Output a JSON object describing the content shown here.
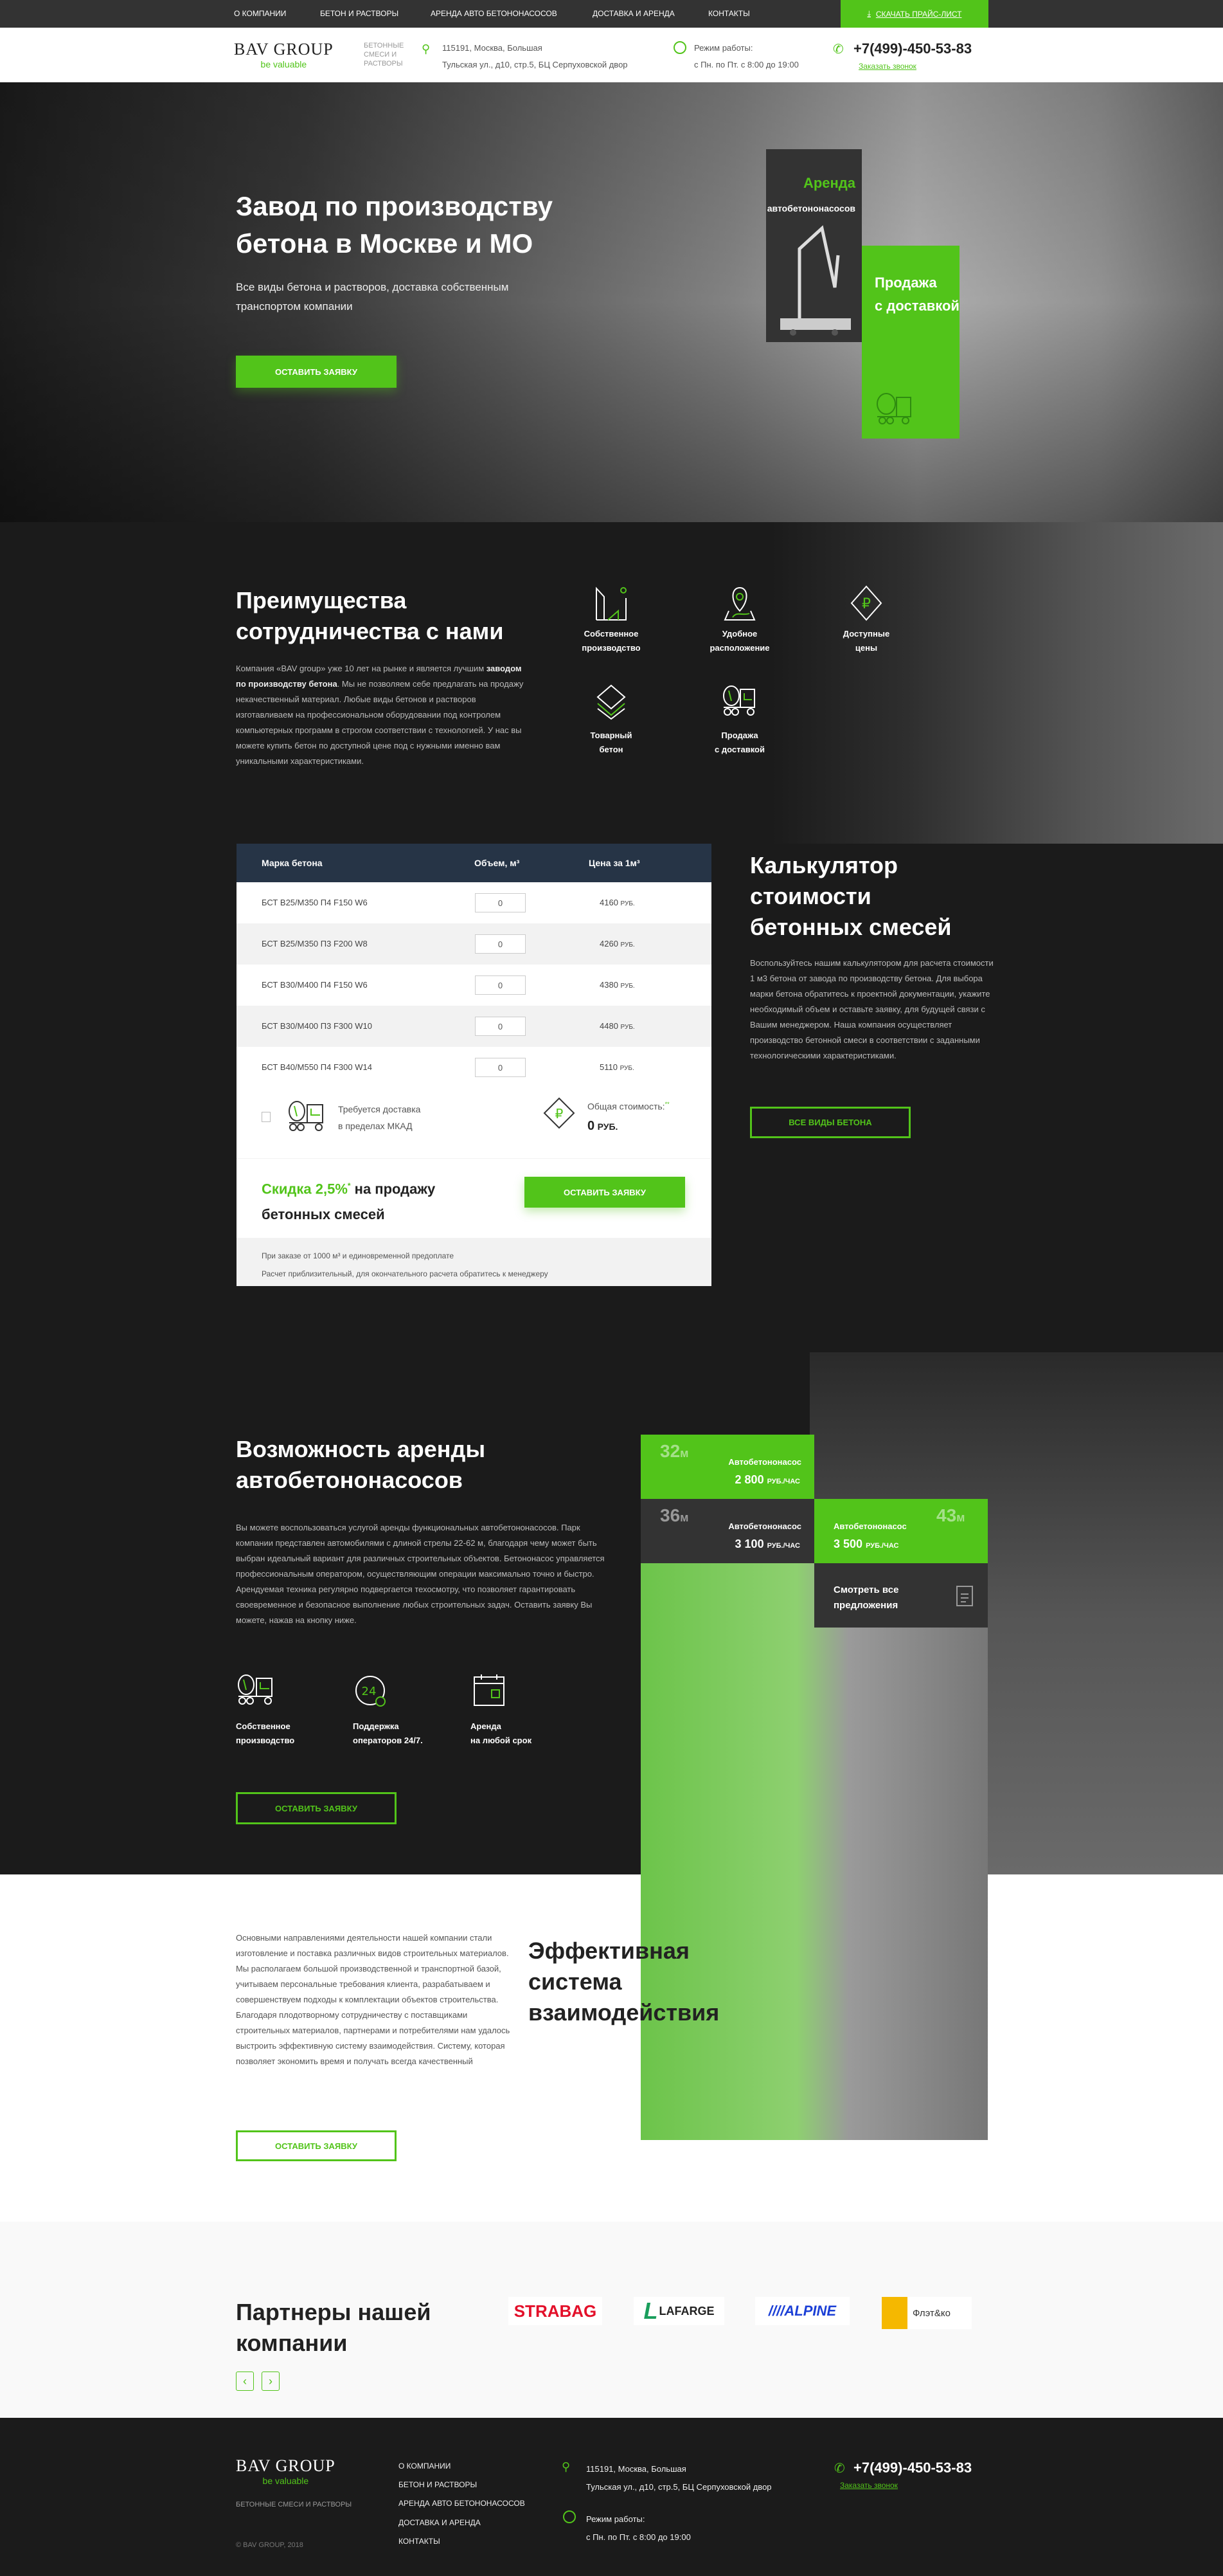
{
  "topnav": {
    "items": [
      "О компании",
      "Бетон и растворы",
      "Аренда авто бетононасосов",
      "Доставка и аренда",
      "Контакты"
    ],
    "price_list": "Скачать прайс-лист"
  },
  "header": {
    "logo": "BAV GROUP",
    "logo_sub": "be valuable",
    "tagline": [
      "БЕТОННЫЕ",
      "СМЕСИ И",
      "РАСТВОРЫ"
    ],
    "address": [
      "115191, Москва, Большая",
      "Тульская ул., д10, стр.5, БЦ Серпуховской двор"
    ],
    "hours": [
      "Режим работы:",
      "с Пн. по Пт. с 8:00 до 19:00"
    ],
    "phone": "+7(499)-450-53-83",
    "call": "Заказать звонок"
  },
  "hero": {
    "title": [
      "Завод по производству",
      "бетона в Москве и МО"
    ],
    "subtitle": [
      "Все виды бетона и растворов, доставка собственным",
      "транспортом компании"
    ],
    "cta": "Оставить заявку",
    "banner_rent": {
      "title": "Аренда",
      "sub": "автобетононасосов"
    },
    "banner_sale": [
      "Продажа",
      "с доставкой"
    ]
  },
  "advantages": {
    "title": [
      "Преимущества",
      "сотрудничества с нами"
    ],
    "text_pre": "Компания «BAV group» уже 10 лет на рынке и является лучшим ",
    "text_bold": "заводом по производству бетона",
    "text_post": ". Мы не позволяем себе предлагать на продажу некачественный материал. Любые виды бетонов и растворов изготавливаем на профессиональном оборудовании под контролем компьютерных программ в строгом соответствии с технологией. У нас вы можете купить бетон по доступной цене под с нужными именно вам уникальными характеристиками.",
    "items": [
      [
        "Собственное",
        "производство"
      ],
      [
        "Удобное",
        "расположение"
      ],
      [
        "Доступные",
        "цены"
      ],
      [
        "Товарный",
        "бетон"
      ],
      [
        "Продажа",
        "с доставкой"
      ]
    ]
  },
  "calculator": {
    "headers": [
      "Марка бетона",
      "Объем, м³",
      "Цена за 1м³"
    ],
    "rows": [
      {
        "grade": "БСТ В25/М350 П4 F150 W6",
        "volume": "0",
        "price": "4160",
        "unit": "РУБ."
      },
      {
        "grade": "БСТ В25/М350 П3 F200 W8",
        "volume": "0",
        "price": "4260",
        "unit": "РУБ."
      },
      {
        "grade": "БСТ В30/М400 П4 F150 W6",
        "volume": "0",
        "price": "4380",
        "unit": "РУБ."
      },
      {
        "grade": "БСТ В30/М400 П3 F300 W10",
        "volume": "0",
        "price": "4480",
        "unit": "РУБ."
      },
      {
        "grade": "БСТ В40/М550 П4 F300 W14",
        "volume": "0",
        "price": "5110",
        "unit": "РУБ."
      }
    ],
    "delivery": [
      "Требуется доставка",
      "в пределах МКАД"
    ],
    "total_label": "Общая стоимость:",
    "total_mark": "**",
    "total_value": "0",
    "total_unit": "РУБ.",
    "discount_green": "Скидка 2,5%",
    "discount_mark": "*",
    "discount_rest": " на продажу",
    "discount_line2": "бетонных смесей",
    "cta": "Оставить заявку",
    "note1": "При заказе от 1000 м³ и единовременной предоплате",
    "note2": "Расчет приблизительный, для окончательного расчета обратитесь к менеджеру",
    "title": [
      "Калькулятор",
      "стоимости",
      "бетонных смесей"
    ],
    "text": "Воспользуйтесь нашим калькулятором для расчета стоимости 1 м3 бетона от завода по производству бетона. Для выбора марки бетона обратитесь к проектной документации, укажите необходимый объем и оставьте заявку, для будущей связи с Вашим менеджером. Наша компания осуществляет производство бетонной смеси в соответствии с заданными технологическими характеристиками.",
    "all_button": "Все виды бетона"
  },
  "rental": {
    "title": [
      "Возможность аренды",
      "автобетононасосов"
    ],
    "text": "Вы можете воспользоваться услугой аренды функциональных автобетононасосов. Парк компании представлен автомобилями с длиной стрелы 22-62 м, благодаря чему может быть выбран идеальный вариант для различных строительных объектов. Бетононасос управляется профессиональным оператором, осуществляющим операции максимально точно и быстро. Арендуемая техника регулярно подвергается техосмотру, что позволяет гарантировать своевременное и безопасное выполнение любых строительных задач. Оставить заявку Вы можете, нажав на кнопку ниже.",
    "features": [
      [
        "Собственное",
        "производство"
      ],
      [
        "Поддержка",
        "операторов 24/7."
      ],
      [
        "Аренда",
        "на любой срок"
      ]
    ],
    "cta": "Оставить заявку",
    "cards": [
      {
        "length": "32",
        "unit": "м",
        "name": "Автобетононасос",
        "price": "2 800",
        "price_unit": "РУБ./ЧАС"
      },
      {
        "length": "36",
        "unit": "м",
        "name": "Автобетононасос",
        "price": "3 100",
        "price_unit": "РУБ./ЧАС"
      },
      {
        "length": "43",
        "unit": "м",
        "name": "Автобетононасос",
        "price": "3 500",
        "price_unit": "РУБ./ЧАС"
      }
    ],
    "all_offers": [
      "Смотреть все",
      "предложения"
    ],
    "colors": {
      "green": "#52c41a",
      "dark": "#333333"
    }
  },
  "system": {
    "text": "Основными направлениями деятельности нашей компании стали изготовление и поставка различных видов строительных материалов. Мы располагаем большой производственной и транспортной базой, учитываем персональные требования клиента, разрабатываем и совершенствуем подходы к комплектации объектов строительства. Благодаря плодотворному сотрудничеству с поставщиками строительных материалов, партнерами и потребителями нам удалось выстроить эффективную систему взаимодействия. Систему, которая позволяет экономить время и получать всегда качественный",
    "title": [
      "Эффективная",
      "система",
      "взаимодействия"
    ],
    "cta": "Оставить заявку"
  },
  "partners": {
    "title": [
      "Партнеры нашей",
      "компании"
    ],
    "logos": [
      "STRABAG",
      "LAFARGE",
      "ALPINE",
      "Флэт&ко"
    ],
    "prev": "‹",
    "next": "›"
  },
  "footer": {
    "logo": "BAV GROUP",
    "logo_sub": "be valuable",
    "tagline": "БЕТОННЫЕ СМЕСИ И РАСТВОРЫ",
    "copyright": "© BAV GROUP, 2018",
    "menu": [
      "О компании",
      "Бетон и растворы",
      "Аренда авто бетононасосов",
      "Доставка и аренда",
      "Контакты"
    ],
    "address": [
      "115191, Москва, Большая",
      "Тульская ул., д10, стр.5, БЦ Серпуховской двор"
    ],
    "hours": [
      "Режим работы:",
      "с Пн. по Пт. с 8:00 до 19:00"
    ],
    "phone": "+7(499)-450-53-83",
    "call": "Заказать звонок"
  }
}
